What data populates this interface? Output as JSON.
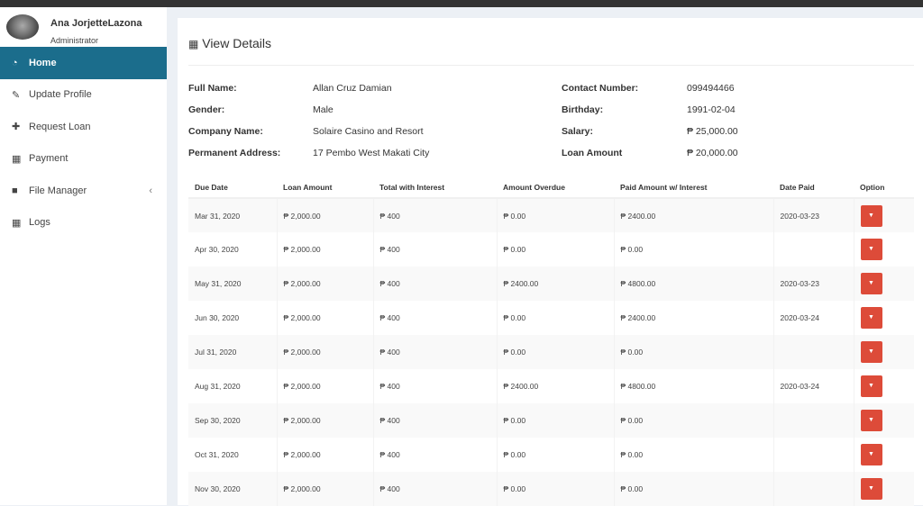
{
  "user": {
    "name": "Ana JorjetteLazona",
    "role": "Administrator"
  },
  "menu": [
    {
      "label": "Home",
      "icon": "dashboard-icon",
      "glyph": "◔"
    },
    {
      "label": "Update Profile",
      "icon": "pencil-icon",
      "glyph": "✎"
    },
    {
      "label": "Request Loan",
      "icon": "plus-icon",
      "glyph": "✚"
    },
    {
      "label": "Payment",
      "icon": "calculator-icon",
      "glyph": "▦"
    },
    {
      "label": "File Manager",
      "icon": "folder-icon",
      "glyph": "■"
    },
    {
      "label": "Logs",
      "icon": "grid-icon",
      "glyph": "▦"
    }
  ],
  "panel": {
    "title": "View Details",
    "icon": "th-icon"
  },
  "details": {
    "full_name_label": "Full Name:",
    "full_name": "Allan Cruz Damian",
    "gender_label": "Gender:",
    "gender": "Male",
    "company_label": "Company Name:",
    "company": "Solaire Casino and Resort",
    "address_label": "Permanent Address:",
    "address": "17 Pembo West Makati City",
    "contact_label": "Contact Number:",
    "contact": "099494466",
    "birthday_label": "Birthday:",
    "birthday": "1991-02-04",
    "salary_label": "Salary:",
    "salary": "₱ 25,000.00",
    "loan_label": "Loan Amount",
    "loan": "₱ 20,000.00"
  },
  "table": {
    "headers": [
      "Due Date",
      "Loan Amount",
      "Total with Interest",
      "Amount Overdue",
      "Paid Amount w/ Interest",
      "Date Paid",
      "Option"
    ],
    "rows": [
      [
        "Mar 31, 2020",
        "₱ 2,000.00",
        "₱ 400",
        "₱ 0.00",
        "₱ 2400.00",
        "2020-03-23"
      ],
      [
        "Apr 30, 2020",
        "₱ 2,000.00",
        "₱ 400",
        "₱ 0.00",
        "₱ 0.00",
        ""
      ],
      [
        "May 31, 2020",
        "₱ 2,000.00",
        "₱ 400",
        "₱ 2400.00",
        "₱ 4800.00",
        "2020-03-23"
      ],
      [
        "Jun 30, 2020",
        "₱ 2,000.00",
        "₱ 400",
        "₱ 0.00",
        "₱ 2400.00",
        "2020-03-24"
      ],
      [
        "Jul 31, 2020",
        "₱ 2,000.00",
        "₱ 400",
        "₱ 0.00",
        "₱ 0.00",
        ""
      ],
      [
        "Aug 31, 2020",
        "₱ 2,000.00",
        "₱ 400",
        "₱ 2400.00",
        "₱ 4800.00",
        "2020-03-24"
      ],
      [
        "Sep 30, 2020",
        "₱ 2,000.00",
        "₱ 400",
        "₱ 0.00",
        "₱ 0.00",
        ""
      ],
      [
        "Oct 31, 2020",
        "₱ 2,000.00",
        "₱ 400",
        "₱ 0.00",
        "₱ 0.00",
        ""
      ],
      [
        "Nov 30, 2020",
        "₱ 2,000.00",
        "₱ 400",
        "₱ 0.00",
        "₱ 0.00",
        ""
      ]
    ]
  }
}
